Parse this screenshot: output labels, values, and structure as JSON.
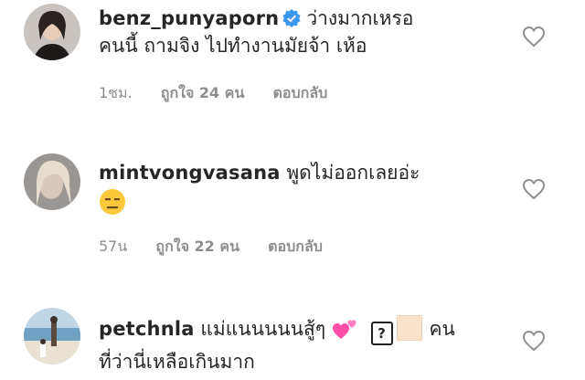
{
  "comments": [
    {
      "username": "benz_punyaporn",
      "text": "ว่างมากเหรอ",
      "text2": "คนนี้ ถามจิง ไปทำงานมัยจ้า  เห้อ",
      "time": "1ชม.",
      "likes": "ถูกใจ 24 คน",
      "reply": "ตอบกลับ"
    },
    {
      "username": "mintvongvasana",
      "text": "พูดไม่ออกเลยอ่ะ",
      "time": "57น",
      "likes": "ถูกใจ 22 คน",
      "reply": "ตอบกลับ"
    },
    {
      "username": "petchnla",
      "text": "แม่แนนนนนสู้ๆ",
      "question_box": "?",
      "text_after": "คน",
      "text2": "ที่ว่านี่เหลือเกินมาก"
    }
  ],
  "colors": {
    "verified": "#3897f0",
    "meta": "#8e8e8e",
    "text": "#262626"
  }
}
